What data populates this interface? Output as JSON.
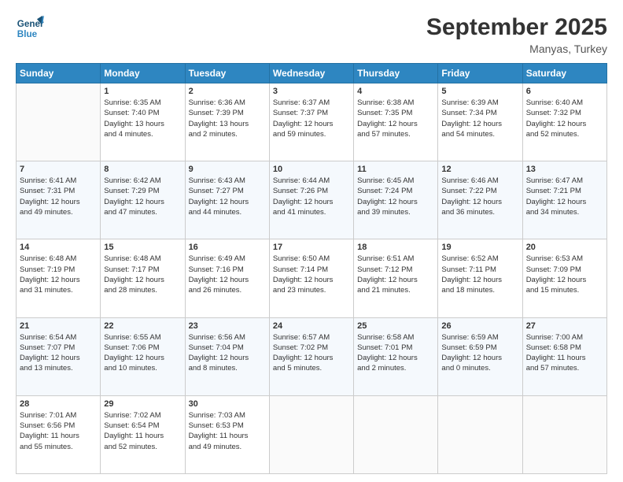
{
  "header": {
    "logo_line1": "General",
    "logo_line2": "Blue",
    "title": "September 2025",
    "subtitle": "Manyas, Turkey"
  },
  "days_of_week": [
    "Sunday",
    "Monday",
    "Tuesday",
    "Wednesday",
    "Thursday",
    "Friday",
    "Saturday"
  ],
  "weeks": [
    [
      {
        "day": "",
        "content": ""
      },
      {
        "day": "1",
        "content": "Sunrise: 6:35 AM\nSunset: 7:40 PM\nDaylight: 13 hours\nand 4 minutes."
      },
      {
        "day": "2",
        "content": "Sunrise: 6:36 AM\nSunset: 7:39 PM\nDaylight: 13 hours\nand 2 minutes."
      },
      {
        "day": "3",
        "content": "Sunrise: 6:37 AM\nSunset: 7:37 PM\nDaylight: 12 hours\nand 59 minutes."
      },
      {
        "day": "4",
        "content": "Sunrise: 6:38 AM\nSunset: 7:35 PM\nDaylight: 12 hours\nand 57 minutes."
      },
      {
        "day": "5",
        "content": "Sunrise: 6:39 AM\nSunset: 7:34 PM\nDaylight: 12 hours\nand 54 minutes."
      },
      {
        "day": "6",
        "content": "Sunrise: 6:40 AM\nSunset: 7:32 PM\nDaylight: 12 hours\nand 52 minutes."
      }
    ],
    [
      {
        "day": "7",
        "content": "Sunrise: 6:41 AM\nSunset: 7:31 PM\nDaylight: 12 hours\nand 49 minutes."
      },
      {
        "day": "8",
        "content": "Sunrise: 6:42 AM\nSunset: 7:29 PM\nDaylight: 12 hours\nand 47 minutes."
      },
      {
        "day": "9",
        "content": "Sunrise: 6:43 AM\nSunset: 7:27 PM\nDaylight: 12 hours\nand 44 minutes."
      },
      {
        "day": "10",
        "content": "Sunrise: 6:44 AM\nSunset: 7:26 PM\nDaylight: 12 hours\nand 41 minutes."
      },
      {
        "day": "11",
        "content": "Sunrise: 6:45 AM\nSunset: 7:24 PM\nDaylight: 12 hours\nand 39 minutes."
      },
      {
        "day": "12",
        "content": "Sunrise: 6:46 AM\nSunset: 7:22 PM\nDaylight: 12 hours\nand 36 minutes."
      },
      {
        "day": "13",
        "content": "Sunrise: 6:47 AM\nSunset: 7:21 PM\nDaylight: 12 hours\nand 34 minutes."
      }
    ],
    [
      {
        "day": "14",
        "content": "Sunrise: 6:48 AM\nSunset: 7:19 PM\nDaylight: 12 hours\nand 31 minutes."
      },
      {
        "day": "15",
        "content": "Sunrise: 6:48 AM\nSunset: 7:17 PM\nDaylight: 12 hours\nand 28 minutes."
      },
      {
        "day": "16",
        "content": "Sunrise: 6:49 AM\nSunset: 7:16 PM\nDaylight: 12 hours\nand 26 minutes."
      },
      {
        "day": "17",
        "content": "Sunrise: 6:50 AM\nSunset: 7:14 PM\nDaylight: 12 hours\nand 23 minutes."
      },
      {
        "day": "18",
        "content": "Sunrise: 6:51 AM\nSunset: 7:12 PM\nDaylight: 12 hours\nand 21 minutes."
      },
      {
        "day": "19",
        "content": "Sunrise: 6:52 AM\nSunset: 7:11 PM\nDaylight: 12 hours\nand 18 minutes."
      },
      {
        "day": "20",
        "content": "Sunrise: 6:53 AM\nSunset: 7:09 PM\nDaylight: 12 hours\nand 15 minutes."
      }
    ],
    [
      {
        "day": "21",
        "content": "Sunrise: 6:54 AM\nSunset: 7:07 PM\nDaylight: 12 hours\nand 13 minutes."
      },
      {
        "day": "22",
        "content": "Sunrise: 6:55 AM\nSunset: 7:06 PM\nDaylight: 12 hours\nand 10 minutes."
      },
      {
        "day": "23",
        "content": "Sunrise: 6:56 AM\nSunset: 7:04 PM\nDaylight: 12 hours\nand 8 minutes."
      },
      {
        "day": "24",
        "content": "Sunrise: 6:57 AM\nSunset: 7:02 PM\nDaylight: 12 hours\nand 5 minutes."
      },
      {
        "day": "25",
        "content": "Sunrise: 6:58 AM\nSunset: 7:01 PM\nDaylight: 12 hours\nand 2 minutes."
      },
      {
        "day": "26",
        "content": "Sunrise: 6:59 AM\nSunset: 6:59 PM\nDaylight: 12 hours\nand 0 minutes."
      },
      {
        "day": "27",
        "content": "Sunrise: 7:00 AM\nSunset: 6:58 PM\nDaylight: 11 hours\nand 57 minutes."
      }
    ],
    [
      {
        "day": "28",
        "content": "Sunrise: 7:01 AM\nSunset: 6:56 PM\nDaylight: 11 hours\nand 55 minutes."
      },
      {
        "day": "29",
        "content": "Sunrise: 7:02 AM\nSunset: 6:54 PM\nDaylight: 11 hours\nand 52 minutes."
      },
      {
        "day": "30",
        "content": "Sunrise: 7:03 AM\nSunset: 6:53 PM\nDaylight: 11 hours\nand 49 minutes."
      },
      {
        "day": "",
        "content": ""
      },
      {
        "day": "",
        "content": ""
      },
      {
        "day": "",
        "content": ""
      },
      {
        "day": "",
        "content": ""
      }
    ]
  ]
}
